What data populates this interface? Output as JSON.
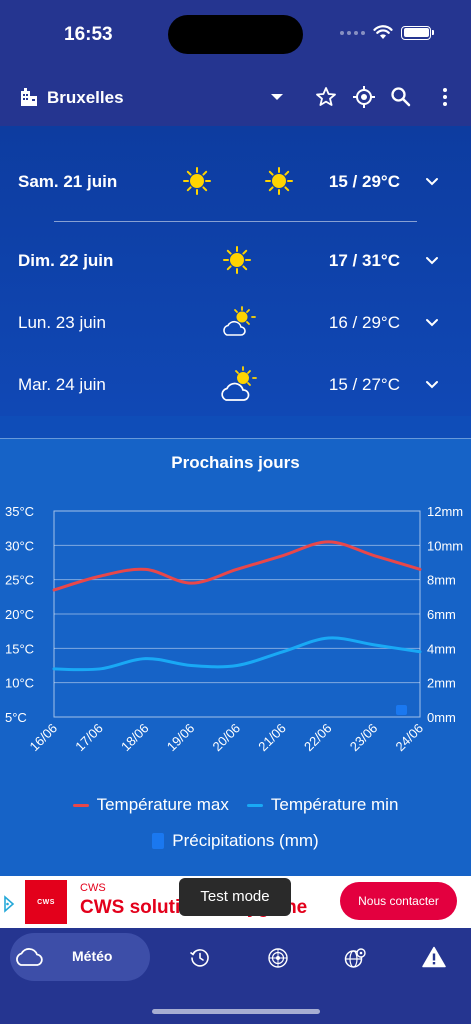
{
  "status_bar": {
    "time": "16:53"
  },
  "header": {
    "city": "Bruxelles",
    "icons": [
      "city-icon",
      "dropdown-icon",
      "star-icon",
      "locate-icon",
      "search-icon",
      "more-icon"
    ]
  },
  "forecast": [
    {
      "day": "Sam. 21 juin",
      "temps": "15 / 29°C",
      "bold": true,
      "icons": [
        "sun-icon",
        "sun-icon"
      ]
    },
    {
      "day": "Dim. 22 juin",
      "temps": "17 / 31°C",
      "bold": true,
      "icons": [
        "sun-icon"
      ]
    },
    {
      "day": "Lun. 23 juin",
      "temps": "16 / 29°C",
      "bold": false,
      "icons": [
        "sun-cloud-icon"
      ]
    },
    {
      "day": "Mar. 24 juin",
      "temps": "15 / 27°C",
      "bold": false,
      "icons": [
        "sun-cloud-icon"
      ]
    }
  ],
  "chart": {
    "title": "Prochains jours",
    "legend_max": "Température max",
    "legend_min": "Température min",
    "legend_precip": "Précipitations (mm)",
    "colors": {
      "max": "#e8474a",
      "min": "#19a9f5",
      "precip": "#1a78f0"
    }
  },
  "chart_data": {
    "type": "line",
    "title": "Prochains jours",
    "x": [
      "16/06",
      "17/06",
      "18/06",
      "19/06",
      "20/06",
      "21/06",
      "22/06",
      "23/06",
      "24/06"
    ],
    "y_left_ticks": [
      "35°C",
      "30°C",
      "25°C",
      "20°C",
      "15°C",
      "10°C",
      "5°C"
    ],
    "y_right_ticks": [
      "12mm",
      "10mm",
      "8mm",
      "6mm",
      "4mm",
      "2mm",
      "0mm"
    ],
    "ylim_left": [
      5,
      35
    ],
    "ylim_right": [
      0,
      12
    ],
    "series": [
      {
        "name": "Température max",
        "axis": "left",
        "values": [
          23.5,
          25.5,
          26.5,
          24.5,
          26.5,
          28.5,
          30.5,
          28.5,
          26.5
        ]
      },
      {
        "name": "Température min",
        "axis": "left",
        "values": [
          12,
          12,
          13.5,
          12.5,
          12.5,
          14.5,
          16.5,
          15.5,
          14.5
        ]
      },
      {
        "name": "Précipitations (mm)",
        "axis": "right",
        "type": "bar",
        "values": [
          0,
          0,
          0,
          0,
          0,
          0,
          0,
          0,
          0.7
        ]
      }
    ],
    "grid": true
  },
  "ad": {
    "brand": "CWS",
    "logo_text": "CWS",
    "headline": "CWS solutions d'hygiène",
    "cta": "Nous contacter"
  },
  "overlay": {
    "test_mode": "Test mode"
  },
  "nav": {
    "meteo_label": "Météo",
    "icons": [
      "cloud-icon",
      "history-icon",
      "radar-icon",
      "globe-icon",
      "alert-icon"
    ]
  }
}
